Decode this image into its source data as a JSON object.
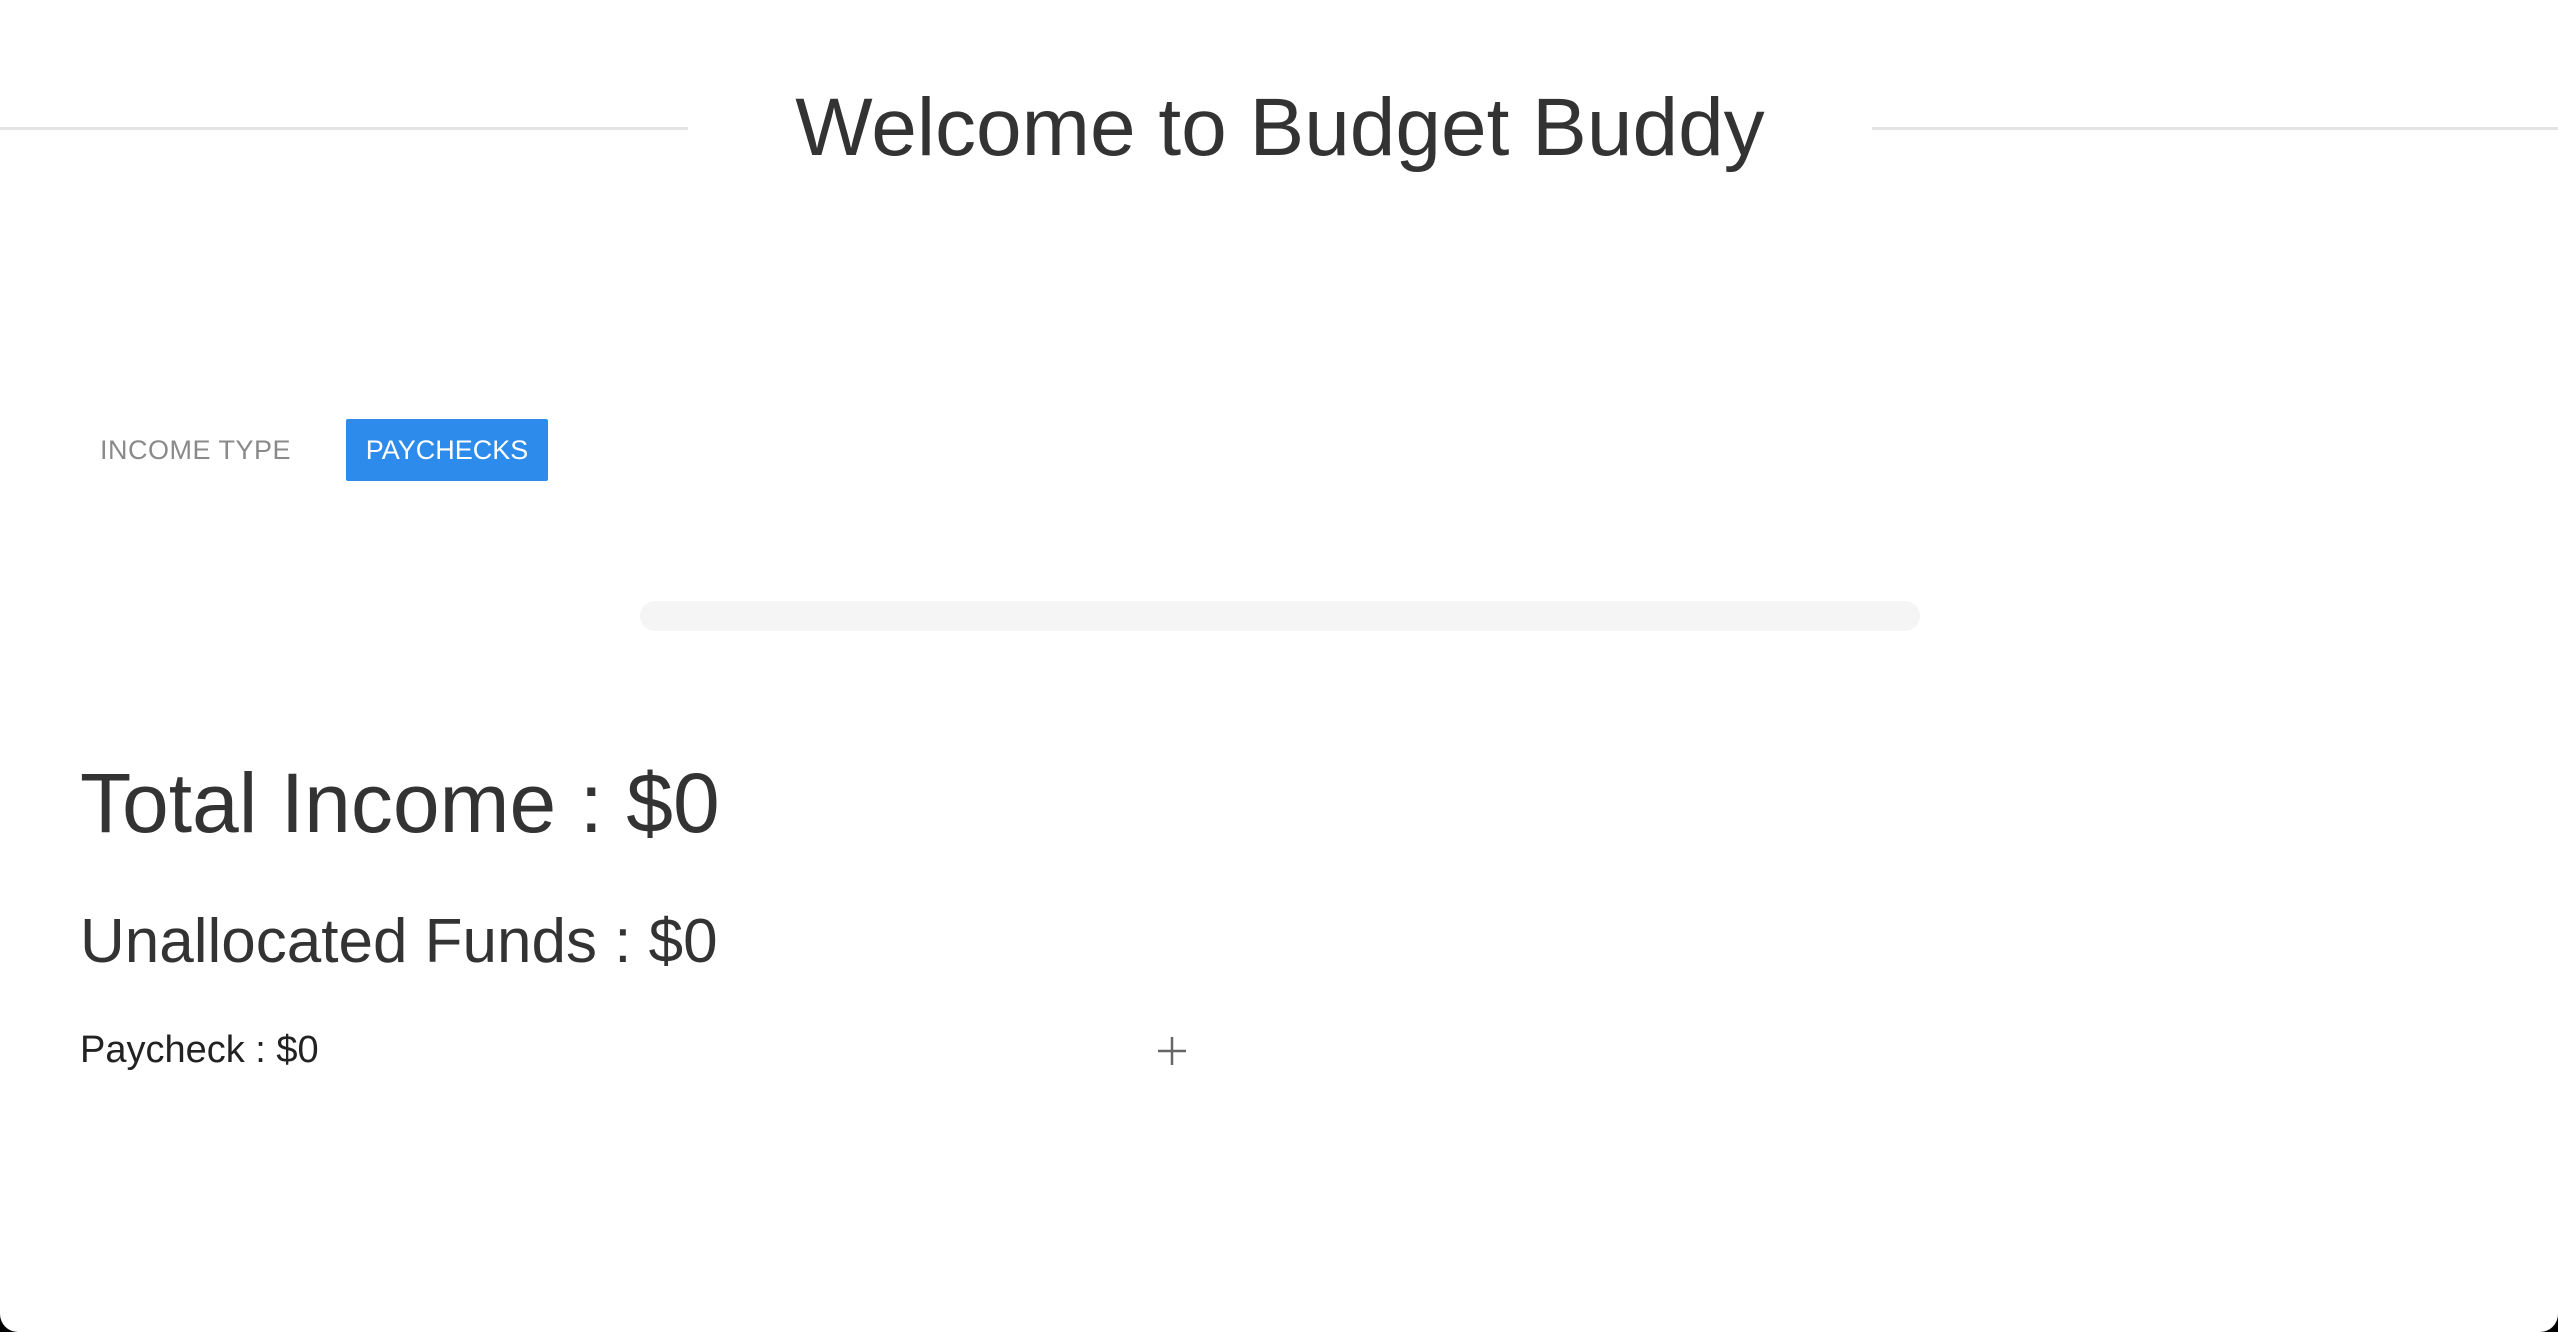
{
  "header": {
    "title": "Welcome to Budget Buddy"
  },
  "income_type": {
    "label": "INCOME TYPE",
    "button_label": "PAYCHECKS",
    "button_color": "#2d8ceb"
  },
  "progress": {
    "allocated_percent": 0
  },
  "summary": {
    "total_income": "Total Income : $0",
    "unallocated_funds": "Unallocated Funds : $0"
  },
  "paychecks": {
    "items": [
      {
        "label": "Paycheck : $0"
      }
    ],
    "add_icon": "plus-icon"
  }
}
